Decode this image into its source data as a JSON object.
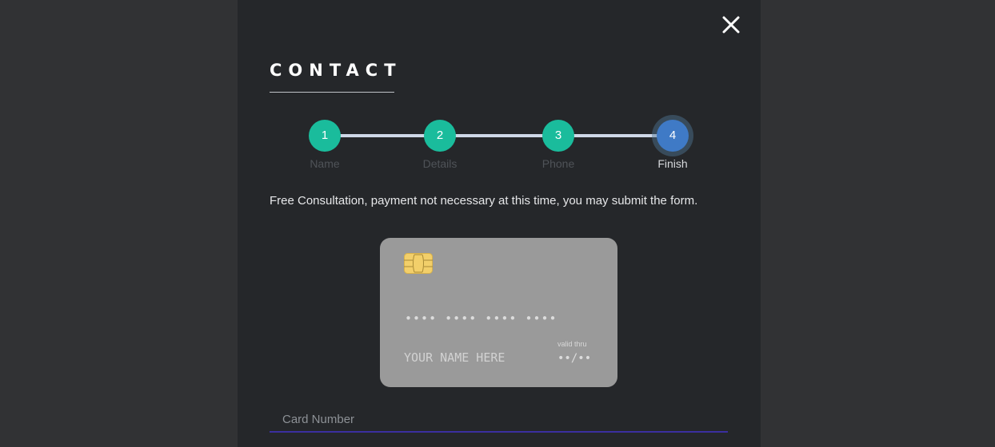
{
  "modal": {
    "title": "CONTACT",
    "close_icon": "close-icon"
  },
  "stepper": {
    "steps": [
      {
        "number": "1",
        "label": "Name",
        "state": "done"
      },
      {
        "number": "2",
        "label": "Details",
        "state": "done"
      },
      {
        "number": "3",
        "label": "Phone",
        "state": "done"
      },
      {
        "number": "4",
        "label": "Finish",
        "state": "active"
      }
    ]
  },
  "notice": "Free Consultation, payment not necessary at this time, you may submit the form.",
  "card_preview": {
    "chip_icon": "card-chip-icon",
    "number": "•••• •••• •••• ••••",
    "name": "YOUR NAME HERE",
    "valid_thru_label": "valid thru",
    "expiry": "••/••"
  },
  "form": {
    "card_number": {
      "placeholder": "Card Number",
      "value": ""
    }
  },
  "colors": {
    "step_done": "#1abc9c",
    "step_active": "#3f7ac6",
    "modal_bg": "#25272a",
    "card_bg": "#9a9a9a",
    "input_underline": "#3b2fa0"
  }
}
